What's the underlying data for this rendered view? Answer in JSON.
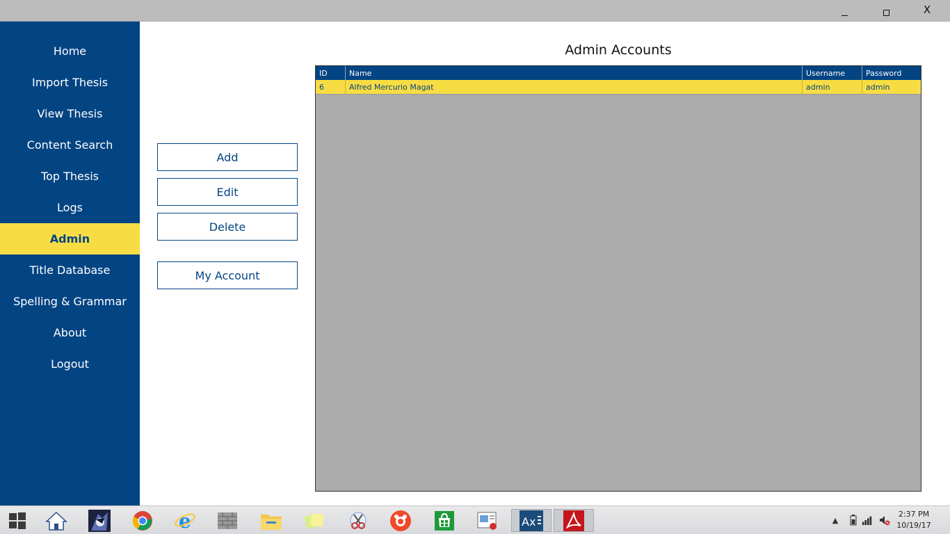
{
  "window": {
    "minimize_icon": "minimize-icon",
    "maximize_icon": "maximize-icon",
    "close_label": "X"
  },
  "sidebar": {
    "items": [
      {
        "label": "Home",
        "active": false
      },
      {
        "label": "Import Thesis",
        "active": false
      },
      {
        "label": "View Thesis",
        "active": false
      },
      {
        "label": "Content Search",
        "active": false
      },
      {
        "label": "Top Thesis",
        "active": false
      },
      {
        "label": "Logs",
        "active": false
      },
      {
        "label": "Admin",
        "active": true
      },
      {
        "label": "Title Database",
        "active": false
      },
      {
        "label": "Spelling & Grammar",
        "active": false
      },
      {
        "label": "About",
        "active": false
      },
      {
        "label": "Logout",
        "active": false
      }
    ]
  },
  "actions": {
    "add_label": "Add",
    "edit_label": "Edit",
    "delete_label": "Delete",
    "my_account_label": "My Account"
  },
  "main": {
    "title": "Admin Accounts",
    "table": {
      "columns": [
        "ID",
        "Name",
        "Username",
        "Password"
      ],
      "rows": [
        [
          "6",
          "Alfred Mercurio Magat",
          "admin",
          "admin"
        ]
      ]
    }
  },
  "colors": {
    "brand_blue": "#034483",
    "accent_yellow": "#f7dd43",
    "grid_bg": "#ababab"
  },
  "taskbar": {
    "apps": [
      "windows-start-icon",
      "home-icon",
      "anime-app-icon",
      "chrome-icon",
      "internet-explorer-icon",
      "firewall-icon",
      "file-explorer-icon",
      "sticky-notes-icon",
      "snipping-tool-icon",
      "camera-app-icon",
      "store-icon",
      "presentation-icon",
      "axure-icon",
      "acrobat-icon"
    ],
    "time": "2:37 PM",
    "date": "10/19/17"
  }
}
